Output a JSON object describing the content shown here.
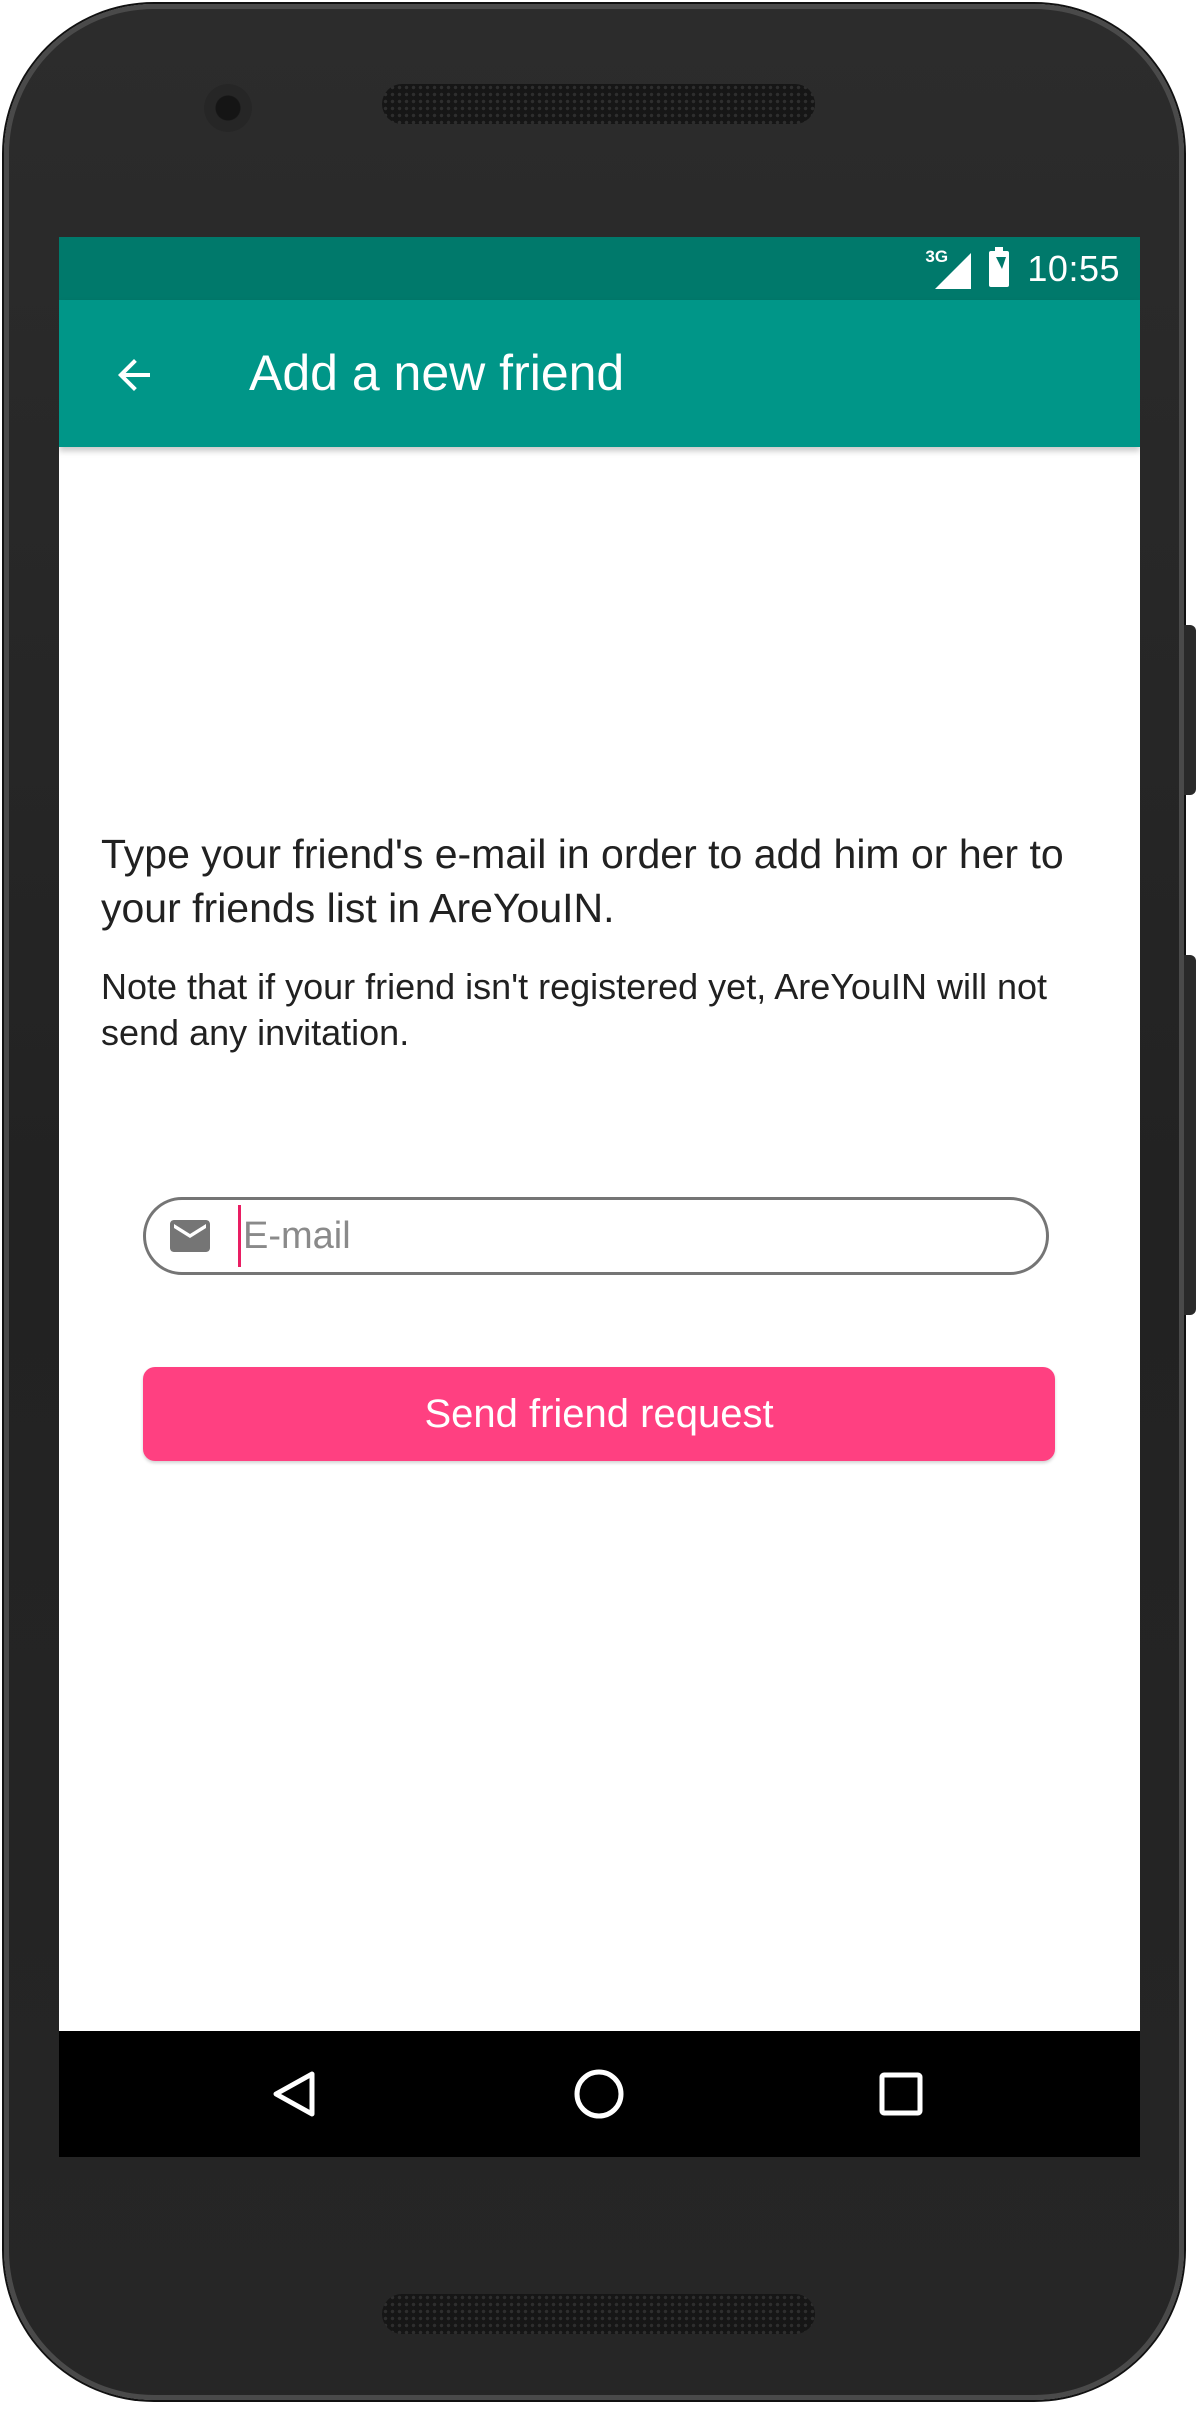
{
  "status_bar": {
    "network_type": "3G",
    "signal_icon": "cellular-signal-icon",
    "battery_icon": "battery-charging-icon",
    "time": "10:55"
  },
  "app_bar": {
    "back_icon": "arrow-left-icon",
    "title": "Add a new friend"
  },
  "content": {
    "intro_text": "Type your friend's e-mail in order to add him or her to your friends list in AreYouIN.",
    "note_text": "Note that if your friend isn't registered yet, AreYouIN will not send any invitation.",
    "email_field": {
      "icon": "envelope-icon",
      "value": "",
      "placeholder": "E-mail"
    },
    "send_button_label": "Send friend request"
  },
  "nav_bar": {
    "back_icon": "triangle-back-icon",
    "home_icon": "circle-home-icon",
    "recents_icon": "square-recents-icon"
  },
  "colors": {
    "status_bar": "#00796b",
    "app_bar": "#009688",
    "accent": "#ff4081",
    "cursor": "#e91e63",
    "text_primary": "#212121",
    "field_border": "#757575",
    "nav_bar": "#000000"
  }
}
